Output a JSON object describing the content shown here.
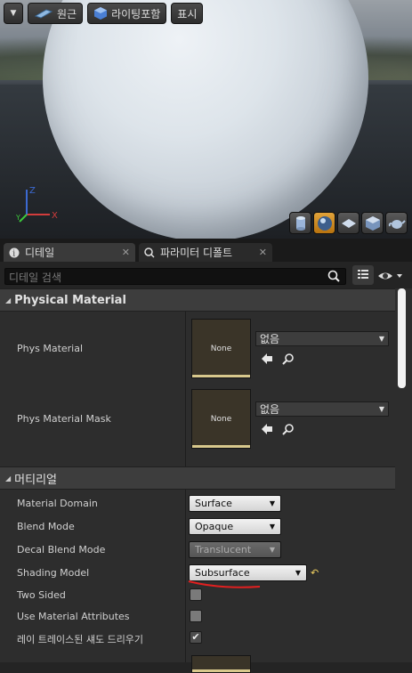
{
  "viewport": {
    "toolbar": {
      "menu_arrow_icon": "chevron-down-icon",
      "perspective_label": "원근",
      "lighting_label": "라이팅포함",
      "show_label": "표시"
    },
    "axis": {
      "x": "X",
      "y": "Y",
      "z": "Z"
    },
    "preview_buttons": [
      "cylinder",
      "sphere",
      "plane",
      "cube",
      "teapot"
    ]
  },
  "tabs": [
    {
      "label": "디테일"
    },
    {
      "label": "파라미터 디폴트"
    }
  ],
  "search": {
    "placeholder": "디테일 검색"
  },
  "categories": {
    "physical": {
      "label": "Physical Material"
    },
    "material": {
      "label": "머티리얼"
    }
  },
  "physical_rows": [
    {
      "label": "Phys Material",
      "thumb": "None",
      "value": "없음"
    },
    {
      "label": "Phys Material Mask",
      "thumb": "None",
      "value": "없음"
    }
  ],
  "material_rows": {
    "material_domain": {
      "label": "Material Domain",
      "value": "Surface"
    },
    "blend_mode": {
      "label": "Blend Mode",
      "value": "Opaque"
    },
    "decal_blend_mode": {
      "label": "Decal Blend Mode",
      "value": "Translucent"
    },
    "shading_model": {
      "label": "Shading Model",
      "value": "Subsurface"
    },
    "two_sided": {
      "label": "Two Sided",
      "checked": false
    },
    "use_material_attributes": {
      "label": "Use Material Attributes",
      "checked": false
    },
    "ray_traced_shadows": {
      "label": "레이 트레이스된 섀도 드리우기",
      "checked": true
    }
  },
  "colors": {
    "accent_orange": "#e1a33a",
    "annotation_red": "#e02020",
    "thumb_stripe": "#d8c88c"
  }
}
